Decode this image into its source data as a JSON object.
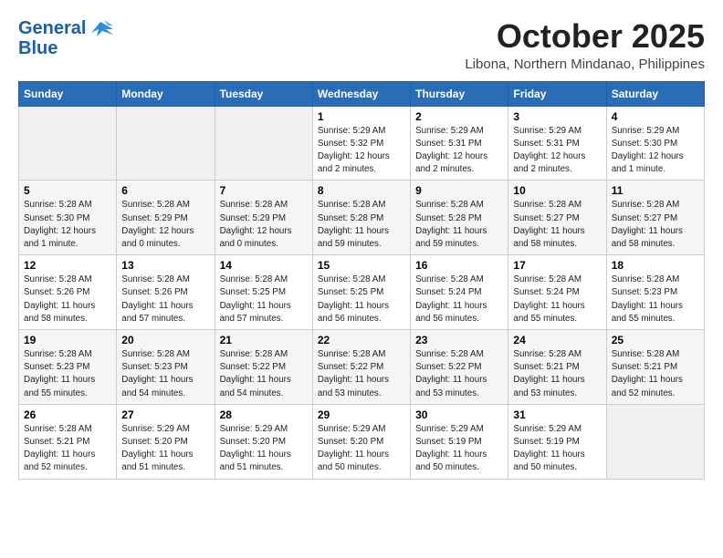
{
  "logo": {
    "text_line1": "General",
    "text_line2": "Blue"
  },
  "title": {
    "month_year": "October 2025",
    "location": "Libona, Northern Mindanao, Philippines"
  },
  "weekdays": [
    "Sunday",
    "Monday",
    "Tuesday",
    "Wednesday",
    "Thursday",
    "Friday",
    "Saturday"
  ],
  "weeks": [
    [
      {
        "day": "",
        "sunrise": "",
        "sunset": "",
        "daylight": "",
        "empty": true
      },
      {
        "day": "",
        "sunrise": "",
        "sunset": "",
        "daylight": "",
        "empty": true
      },
      {
        "day": "",
        "sunrise": "",
        "sunset": "",
        "daylight": "",
        "empty": true
      },
      {
        "day": "1",
        "sunrise": "Sunrise: 5:29 AM",
        "sunset": "Sunset: 5:32 PM",
        "daylight": "Daylight: 12 hours and 2 minutes."
      },
      {
        "day": "2",
        "sunrise": "Sunrise: 5:29 AM",
        "sunset": "Sunset: 5:31 PM",
        "daylight": "Daylight: 12 hours and 2 minutes."
      },
      {
        "day": "3",
        "sunrise": "Sunrise: 5:29 AM",
        "sunset": "Sunset: 5:31 PM",
        "daylight": "Daylight: 12 hours and 2 minutes."
      },
      {
        "day": "4",
        "sunrise": "Sunrise: 5:29 AM",
        "sunset": "Sunset: 5:30 PM",
        "daylight": "Daylight: 12 hours and 1 minute."
      }
    ],
    [
      {
        "day": "5",
        "sunrise": "Sunrise: 5:28 AM",
        "sunset": "Sunset: 5:30 PM",
        "daylight": "Daylight: 12 hours and 1 minute."
      },
      {
        "day": "6",
        "sunrise": "Sunrise: 5:28 AM",
        "sunset": "Sunset: 5:29 PM",
        "daylight": "Daylight: 12 hours and 0 minutes."
      },
      {
        "day": "7",
        "sunrise": "Sunrise: 5:28 AM",
        "sunset": "Sunset: 5:29 PM",
        "daylight": "Daylight: 12 hours and 0 minutes."
      },
      {
        "day": "8",
        "sunrise": "Sunrise: 5:28 AM",
        "sunset": "Sunset: 5:28 PM",
        "daylight": "Daylight: 11 hours and 59 minutes."
      },
      {
        "day": "9",
        "sunrise": "Sunrise: 5:28 AM",
        "sunset": "Sunset: 5:28 PM",
        "daylight": "Daylight: 11 hours and 59 minutes."
      },
      {
        "day": "10",
        "sunrise": "Sunrise: 5:28 AM",
        "sunset": "Sunset: 5:27 PM",
        "daylight": "Daylight: 11 hours and 58 minutes."
      },
      {
        "day": "11",
        "sunrise": "Sunrise: 5:28 AM",
        "sunset": "Sunset: 5:27 PM",
        "daylight": "Daylight: 11 hours and 58 minutes."
      }
    ],
    [
      {
        "day": "12",
        "sunrise": "Sunrise: 5:28 AM",
        "sunset": "Sunset: 5:26 PM",
        "daylight": "Daylight: 11 hours and 58 minutes."
      },
      {
        "day": "13",
        "sunrise": "Sunrise: 5:28 AM",
        "sunset": "Sunset: 5:26 PM",
        "daylight": "Daylight: 11 hours and 57 minutes."
      },
      {
        "day": "14",
        "sunrise": "Sunrise: 5:28 AM",
        "sunset": "Sunset: 5:25 PM",
        "daylight": "Daylight: 11 hours and 57 minutes."
      },
      {
        "day": "15",
        "sunrise": "Sunrise: 5:28 AM",
        "sunset": "Sunset: 5:25 PM",
        "daylight": "Daylight: 11 hours and 56 minutes."
      },
      {
        "day": "16",
        "sunrise": "Sunrise: 5:28 AM",
        "sunset": "Sunset: 5:24 PM",
        "daylight": "Daylight: 11 hours and 56 minutes."
      },
      {
        "day": "17",
        "sunrise": "Sunrise: 5:28 AM",
        "sunset": "Sunset: 5:24 PM",
        "daylight": "Daylight: 11 hours and 55 minutes."
      },
      {
        "day": "18",
        "sunrise": "Sunrise: 5:28 AM",
        "sunset": "Sunset: 5:23 PM",
        "daylight": "Daylight: 11 hours and 55 minutes."
      }
    ],
    [
      {
        "day": "19",
        "sunrise": "Sunrise: 5:28 AM",
        "sunset": "Sunset: 5:23 PM",
        "daylight": "Daylight: 11 hours and 55 minutes."
      },
      {
        "day": "20",
        "sunrise": "Sunrise: 5:28 AM",
        "sunset": "Sunset: 5:23 PM",
        "daylight": "Daylight: 11 hours and 54 minutes."
      },
      {
        "day": "21",
        "sunrise": "Sunrise: 5:28 AM",
        "sunset": "Sunset: 5:22 PM",
        "daylight": "Daylight: 11 hours and 54 minutes."
      },
      {
        "day": "22",
        "sunrise": "Sunrise: 5:28 AM",
        "sunset": "Sunset: 5:22 PM",
        "daylight": "Daylight: 11 hours and 53 minutes."
      },
      {
        "day": "23",
        "sunrise": "Sunrise: 5:28 AM",
        "sunset": "Sunset: 5:22 PM",
        "daylight": "Daylight: 11 hours and 53 minutes."
      },
      {
        "day": "24",
        "sunrise": "Sunrise: 5:28 AM",
        "sunset": "Sunset: 5:21 PM",
        "daylight": "Daylight: 11 hours and 53 minutes."
      },
      {
        "day": "25",
        "sunrise": "Sunrise: 5:28 AM",
        "sunset": "Sunset: 5:21 PM",
        "daylight": "Daylight: 11 hours and 52 minutes."
      }
    ],
    [
      {
        "day": "26",
        "sunrise": "Sunrise: 5:28 AM",
        "sunset": "Sunset: 5:21 PM",
        "daylight": "Daylight: 11 hours and 52 minutes."
      },
      {
        "day": "27",
        "sunrise": "Sunrise: 5:29 AM",
        "sunset": "Sunset: 5:20 PM",
        "daylight": "Daylight: 11 hours and 51 minutes."
      },
      {
        "day": "28",
        "sunrise": "Sunrise: 5:29 AM",
        "sunset": "Sunset: 5:20 PM",
        "daylight": "Daylight: 11 hours and 51 minutes."
      },
      {
        "day": "29",
        "sunrise": "Sunrise: 5:29 AM",
        "sunset": "Sunset: 5:20 PM",
        "daylight": "Daylight: 11 hours and 50 minutes."
      },
      {
        "day": "30",
        "sunrise": "Sunrise: 5:29 AM",
        "sunset": "Sunset: 5:19 PM",
        "daylight": "Daylight: 11 hours and 50 minutes."
      },
      {
        "day": "31",
        "sunrise": "Sunrise: 5:29 AM",
        "sunset": "Sunset: 5:19 PM",
        "daylight": "Daylight: 11 hours and 50 minutes."
      },
      {
        "day": "",
        "sunrise": "",
        "sunset": "",
        "daylight": "",
        "empty": true
      }
    ]
  ]
}
